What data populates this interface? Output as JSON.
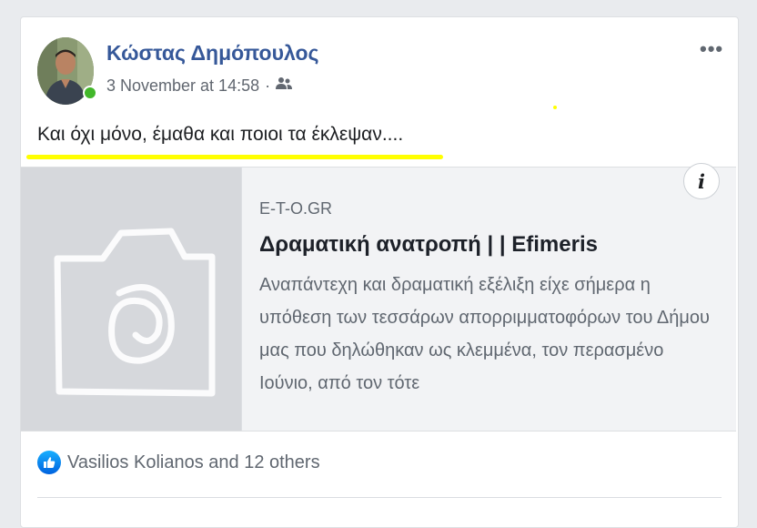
{
  "post": {
    "author": "Κώστας Δημόπουλος",
    "timestamp": "3 November at 14:58",
    "separator": "·",
    "audience_icon": "friends-icon",
    "text": "Και όχι μόνο, έμαθα και ποιοι τα έκλεψαν....",
    "more_label": "•••"
  },
  "link": {
    "domain": "E-T-O.GR",
    "title": "Δραματική ανατροπή | | Efimeris",
    "description": "Αναπάντεχη και δραματική εξέλιξη είχε σήμερα η υπόθεση των τεσσάρων απορριμματοφόρων του Δήμου μας που δηλώθηκαν ως κλεμμένα, τον περασμένο Ιούνιο, από τον τότε",
    "info_label": "i",
    "thumbnail_icon": "camera-placeholder-icon"
  },
  "reactions": {
    "icon": "like-icon",
    "text": "Vasilios Kolianos and 12 others"
  },
  "colors": {
    "author": "#365899",
    "highlight": "#ffff00",
    "online": "#42b72a",
    "like": "#1877f2"
  }
}
